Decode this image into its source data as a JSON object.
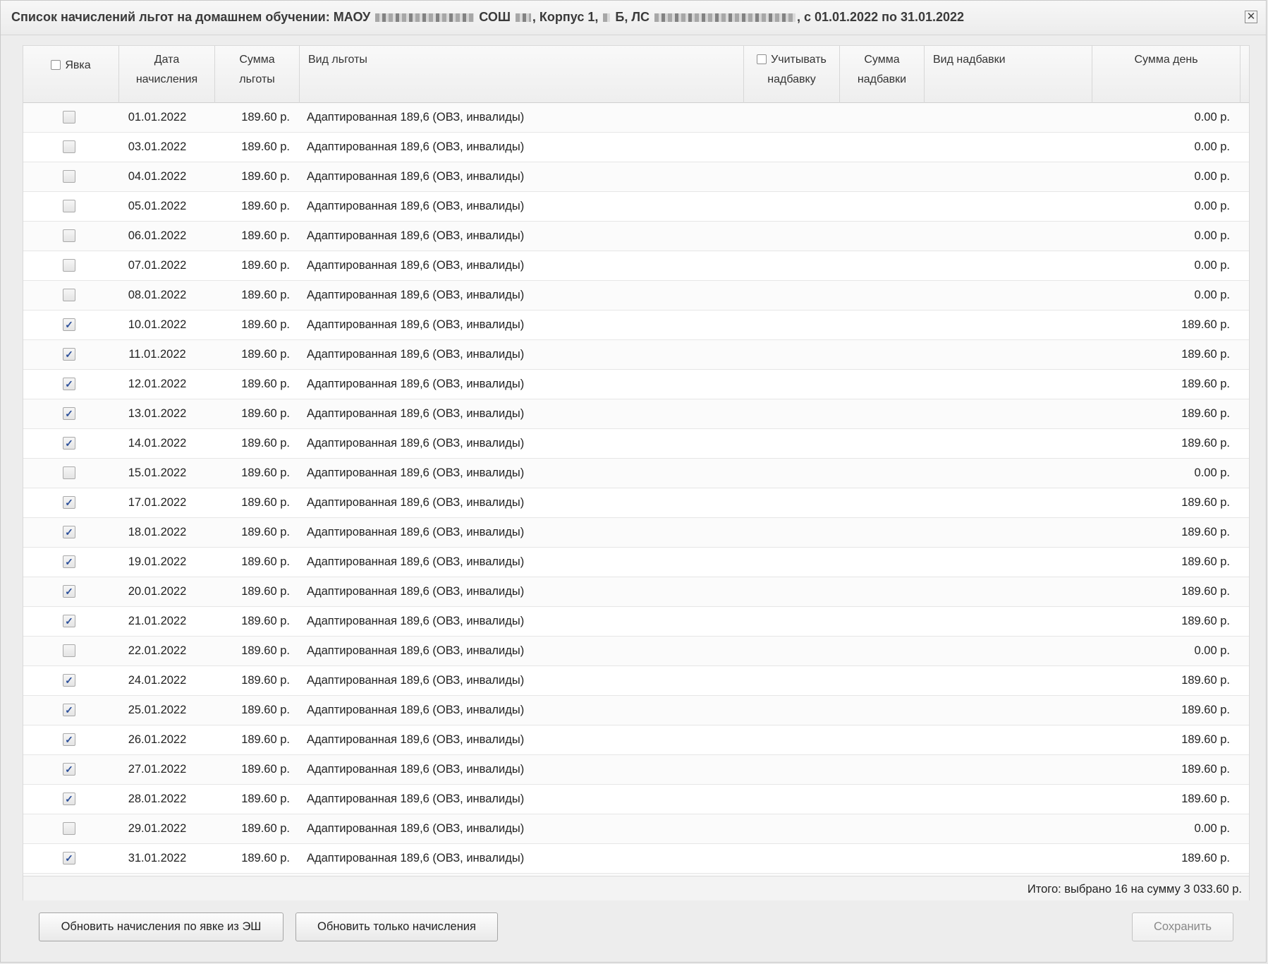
{
  "dialog": {
    "title_part1": "Список начислений льгот на домашнем обучении: МАОУ",
    "title_part2": "СОШ",
    "title_part3": ", Корпус 1,",
    "title_part4": "Б, ЛС",
    "title_part5": ", с 01.01.2022 по 31.01.2022",
    "close_label": "✕"
  },
  "header": {
    "attendance": "Явка",
    "date_line1": "Дата",
    "date_line2": "начисления",
    "sum_line1": "Сумма",
    "sum_line2": "льготы",
    "benefit_type": "Вид льготы",
    "include_bonus_line1": "Учитывать",
    "include_bonus_line2": "надбавку",
    "bonus_sum_line1": "Сумма",
    "bonus_sum_line2": "надбавки",
    "bonus_type": "Вид надбавки",
    "day_sum": "Сумма день"
  },
  "rows": [
    {
      "checked": false,
      "date": "01.01.2022",
      "sum": "189.60 р.",
      "type": "Адаптированная 189,6 (ОВЗ, инвалиды)",
      "day": "0.00 р."
    },
    {
      "checked": false,
      "date": "03.01.2022",
      "sum": "189.60 р.",
      "type": "Адаптированная 189,6 (ОВЗ, инвалиды)",
      "day": "0.00 р."
    },
    {
      "checked": false,
      "date": "04.01.2022",
      "sum": "189.60 р.",
      "type": "Адаптированная 189,6 (ОВЗ, инвалиды)",
      "day": "0.00 р."
    },
    {
      "checked": false,
      "date": "05.01.2022",
      "sum": "189.60 р.",
      "type": "Адаптированная 189,6 (ОВЗ, инвалиды)",
      "day": "0.00 р."
    },
    {
      "checked": false,
      "date": "06.01.2022",
      "sum": "189.60 р.",
      "type": "Адаптированная 189,6 (ОВЗ, инвалиды)",
      "day": "0.00 р."
    },
    {
      "checked": false,
      "date": "07.01.2022",
      "sum": "189.60 р.",
      "type": "Адаптированная 189,6 (ОВЗ, инвалиды)",
      "day": "0.00 р."
    },
    {
      "checked": false,
      "date": "08.01.2022",
      "sum": "189.60 р.",
      "type": "Адаптированная 189,6 (ОВЗ, инвалиды)",
      "day": "0.00 р."
    },
    {
      "checked": true,
      "date": "10.01.2022",
      "sum": "189.60 р.",
      "type": "Адаптированная 189,6 (ОВЗ, инвалиды)",
      "day": "189.60 р."
    },
    {
      "checked": true,
      "date": "11.01.2022",
      "sum": "189.60 р.",
      "type": "Адаптированная 189,6 (ОВЗ, инвалиды)",
      "day": "189.60 р."
    },
    {
      "checked": true,
      "date": "12.01.2022",
      "sum": "189.60 р.",
      "type": "Адаптированная 189,6 (ОВЗ, инвалиды)",
      "day": "189.60 р."
    },
    {
      "checked": true,
      "date": "13.01.2022",
      "sum": "189.60 р.",
      "type": "Адаптированная 189,6 (ОВЗ, инвалиды)",
      "day": "189.60 р."
    },
    {
      "checked": true,
      "date": "14.01.2022",
      "sum": "189.60 р.",
      "type": "Адаптированная 189,6 (ОВЗ, инвалиды)",
      "day": "189.60 р."
    },
    {
      "checked": false,
      "date": "15.01.2022",
      "sum": "189.60 р.",
      "type": "Адаптированная 189,6 (ОВЗ, инвалиды)",
      "day": "0.00 р."
    },
    {
      "checked": true,
      "date": "17.01.2022",
      "sum": "189.60 р.",
      "type": "Адаптированная 189,6 (ОВЗ, инвалиды)",
      "day": "189.60 р."
    },
    {
      "checked": true,
      "date": "18.01.2022",
      "sum": "189.60 р.",
      "type": "Адаптированная 189,6 (ОВЗ, инвалиды)",
      "day": "189.60 р."
    },
    {
      "checked": true,
      "date": "19.01.2022",
      "sum": "189.60 р.",
      "type": "Адаптированная 189,6 (ОВЗ, инвалиды)",
      "day": "189.60 р."
    },
    {
      "checked": true,
      "date": "20.01.2022",
      "sum": "189.60 р.",
      "type": "Адаптированная 189,6 (ОВЗ, инвалиды)",
      "day": "189.60 р."
    },
    {
      "checked": true,
      "date": "21.01.2022",
      "sum": "189.60 р.",
      "type": "Адаптированная 189,6 (ОВЗ, инвалиды)",
      "day": "189.60 р."
    },
    {
      "checked": false,
      "date": "22.01.2022",
      "sum": "189.60 р.",
      "type": "Адаптированная 189,6 (ОВЗ, инвалиды)",
      "day": "0.00 р."
    },
    {
      "checked": true,
      "date": "24.01.2022",
      "sum": "189.60 р.",
      "type": "Адаптированная 189,6 (ОВЗ, инвалиды)",
      "day": "189.60 р."
    },
    {
      "checked": true,
      "date": "25.01.2022",
      "sum": "189.60 р.",
      "type": "Адаптированная 189,6 (ОВЗ, инвалиды)",
      "day": "189.60 р."
    },
    {
      "checked": true,
      "date": "26.01.2022",
      "sum": "189.60 р.",
      "type": "Адаптированная 189,6 (ОВЗ, инвалиды)",
      "day": "189.60 р."
    },
    {
      "checked": true,
      "date": "27.01.2022",
      "sum": "189.60 р.",
      "type": "Адаптированная 189,6 (ОВЗ, инвалиды)",
      "day": "189.60 р."
    },
    {
      "checked": true,
      "date": "28.01.2022",
      "sum": "189.60 р.",
      "type": "Адаптированная 189,6 (ОВЗ, инвалиды)",
      "day": "189.60 р."
    },
    {
      "checked": false,
      "date": "29.01.2022",
      "sum": "189.60 р.",
      "type": "Адаптированная 189,6 (ОВЗ, инвалиды)",
      "day": "0.00 р."
    },
    {
      "checked": true,
      "date": "31.01.2022",
      "sum": "189.60 р.",
      "type": "Адаптированная 189,6 (ОВЗ, инвалиды)",
      "day": "189.60 р."
    }
  ],
  "total": "Итого: выбрано 16 на сумму 3 033.60 р.",
  "buttons": {
    "refresh_attendance": "Обновить начисления по явке из ЭШ",
    "refresh_only": "Обновить только начисления",
    "save": "Сохранить"
  },
  "check_glyph": "✓"
}
